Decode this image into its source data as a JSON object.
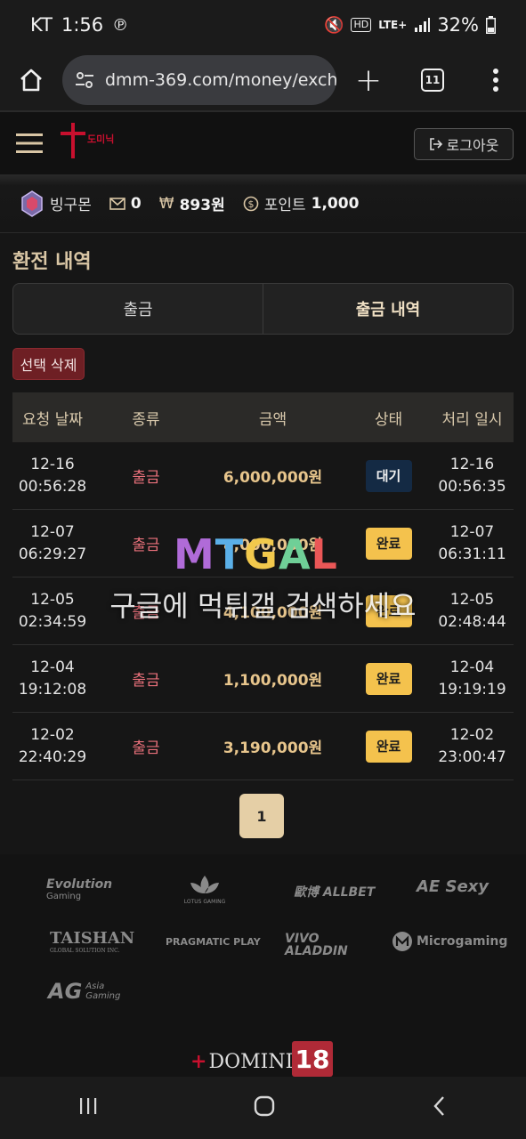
{
  "status": {
    "carrier": "KT",
    "time": "1:56",
    "hd": "HD",
    "lte": "LTE+",
    "battery": "32%"
  },
  "browser": {
    "url": "dmm-369.com/money/exchange",
    "tab_count": "11"
  },
  "header": {
    "logo_text": "도미닉",
    "logout_label": "로그아웃"
  },
  "user": {
    "name": "빙구몬",
    "messages": "0",
    "balance": "893원",
    "points_label": "포인트",
    "points": "1,000"
  },
  "page": {
    "title": "환전 내역",
    "tabs": [
      {
        "label": "출금"
      },
      {
        "label": "출금 내역"
      }
    ],
    "delete_label": "선택 삭제",
    "columns": [
      "요청 날짜",
      "종류",
      "금액",
      "상태",
      "처리 일시"
    ],
    "rows": [
      {
        "req_date": "12-16",
        "req_time": "00:56:28",
        "kind": "출금",
        "amount": "6,000,000원",
        "status": "대기",
        "proc_date": "12-16",
        "proc_time": "00:56:35"
      },
      {
        "req_date": "12-07",
        "req_time": "06:29:27",
        "kind": "출금",
        "amount": "8,000,000원",
        "status": "완료",
        "proc_date": "12-07",
        "proc_time": "06:31:11"
      },
      {
        "req_date": "12-05",
        "req_time": "02:34:59",
        "kind": "출금",
        "amount": "4,100,000원",
        "status": "완료",
        "proc_date": "12-05",
        "proc_time": "02:48:44"
      },
      {
        "req_date": "12-04",
        "req_time": "19:12:08",
        "kind": "출금",
        "amount": "1,100,000원",
        "status": "완료",
        "proc_date": "12-04",
        "proc_time": "19:19:19"
      },
      {
        "req_date": "12-02",
        "req_time": "22:40:29",
        "kind": "출금",
        "amount": "3,190,000원",
        "status": "완료",
        "proc_date": "12-02",
        "proc_time": "23:00:47"
      }
    ],
    "page_number": "1"
  },
  "watermark": {
    "logo": [
      "M",
      "T",
      "G",
      "A",
      "L",
      ""
    ],
    "text": "구글에 먹튀갤 검색하세요"
  },
  "providers": {
    "evolution": "Evolution",
    "evolution_sub": "Gaming",
    "lotus": "LOTUS GAMING",
    "allbet": "歐博 ALLBET",
    "aesexy": "AE Sexy",
    "taishan": "TAISHAN",
    "taishan_sub": "GLOBAL SOLUTION INC.",
    "pragmatic": "PRAGMATIC PLAY",
    "vivo": "VIVO ALADDIN",
    "micro": "Microgaming",
    "ag": "AG",
    "ag_sub": "Asia Gaming"
  },
  "footer": {
    "logo_text": "DOMINIC",
    "age": "18"
  }
}
